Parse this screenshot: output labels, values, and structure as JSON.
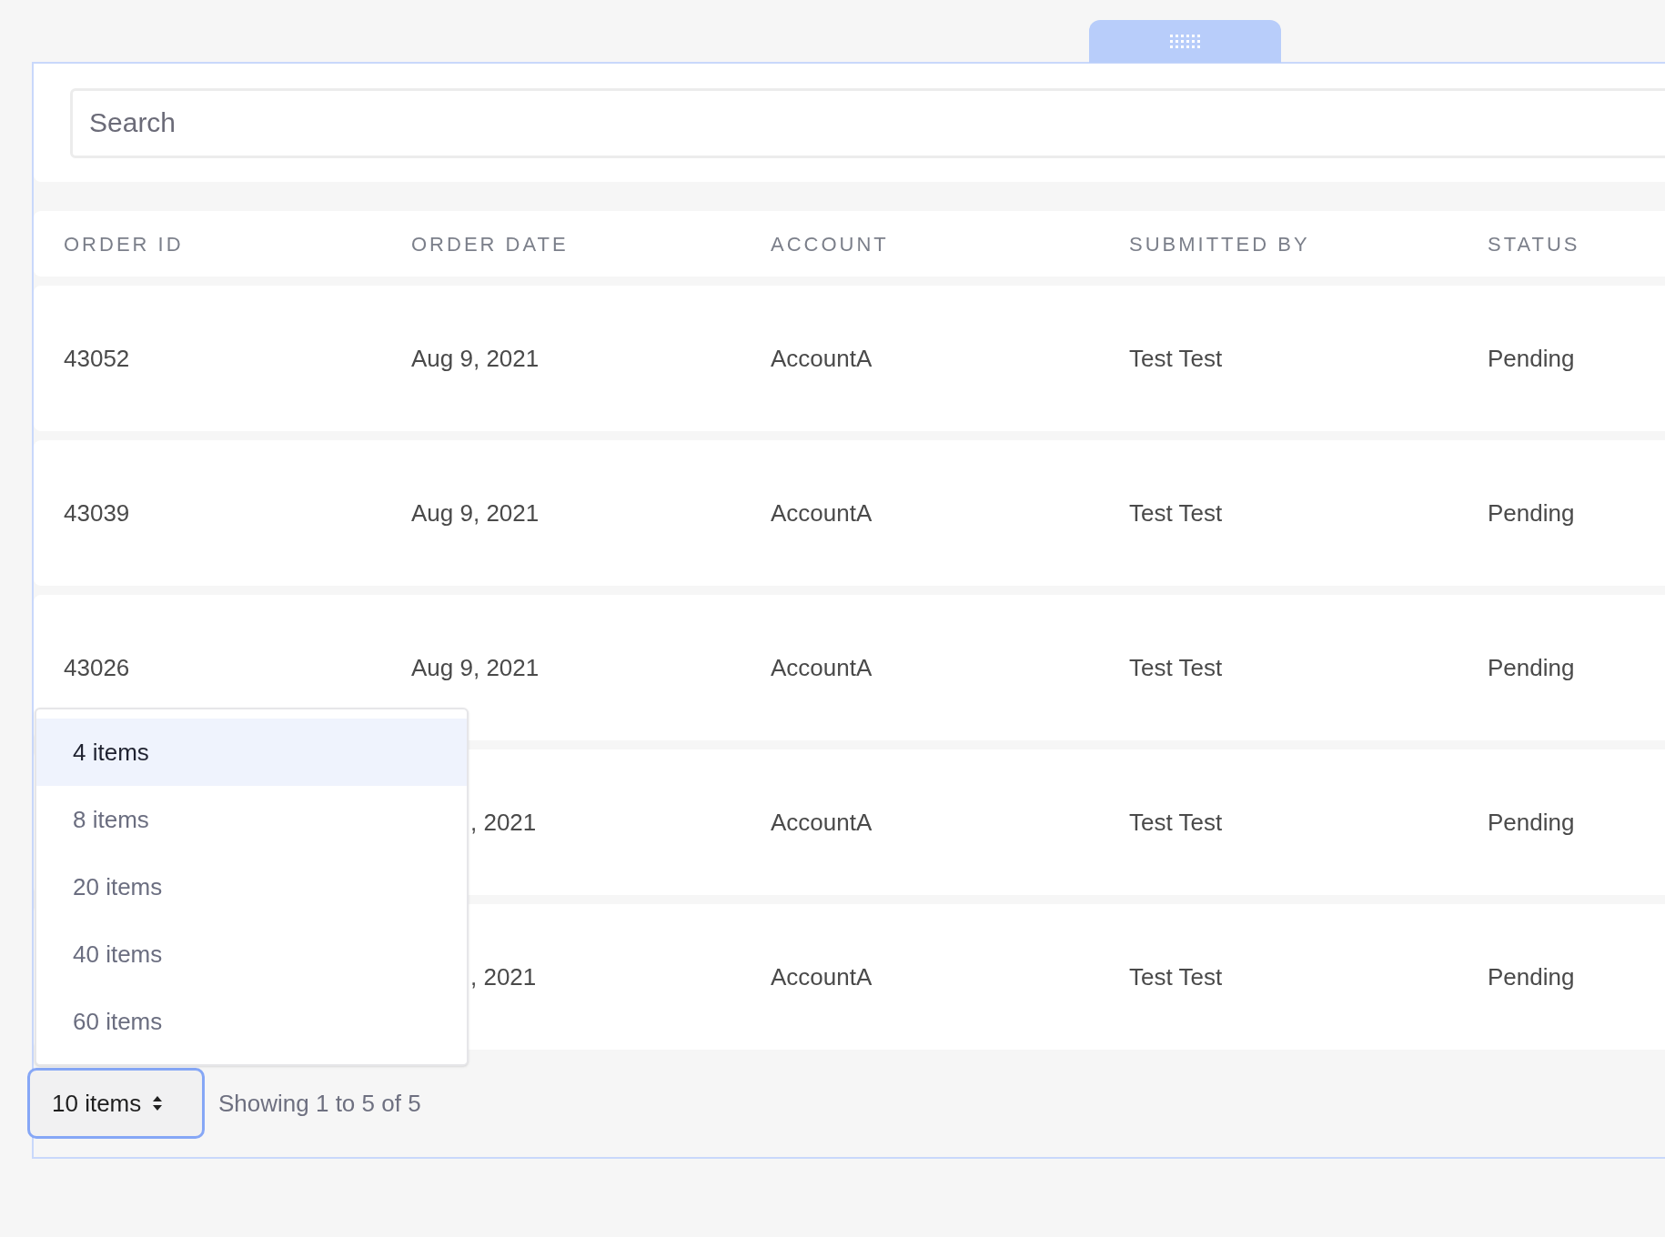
{
  "search": {
    "placeholder": "Search"
  },
  "table": {
    "columns": [
      "ORDER ID",
      "ORDER DATE",
      "ACCOUNT",
      "SUBMITTED BY",
      "STATUS"
    ],
    "rows": [
      {
        "order_id": "43052",
        "order_date": "Aug 9, 2021",
        "account": "AccountA",
        "submitted_by": "Test Test",
        "status": "Pending"
      },
      {
        "order_id": "43039",
        "order_date": "Aug 9, 2021",
        "account": "AccountA",
        "submitted_by": "Test Test",
        "status": "Pending"
      },
      {
        "order_id": "43026",
        "order_date": "Aug 9, 2021",
        "account": "AccountA",
        "submitted_by": "Test Test",
        "status": "Pending"
      },
      {
        "order_date": ", 2021",
        "account": "AccountA",
        "submitted_by": "Test Test",
        "status": "Pending"
      },
      {
        "order_date": ", 2021",
        "account": "AccountA",
        "submitted_by": "Test Test",
        "status": "Pending"
      }
    ]
  },
  "page_size": {
    "value": "10 items",
    "expanded": true,
    "options": [
      {
        "label": "4 items",
        "selected": true
      },
      {
        "label": "8 items",
        "selected": false
      },
      {
        "label": "20 items",
        "selected": false
      },
      {
        "label": "40 items",
        "selected": false
      },
      {
        "label": "60 items",
        "selected": false
      }
    ]
  },
  "summary": "Showing 1 to 5 of 5"
}
